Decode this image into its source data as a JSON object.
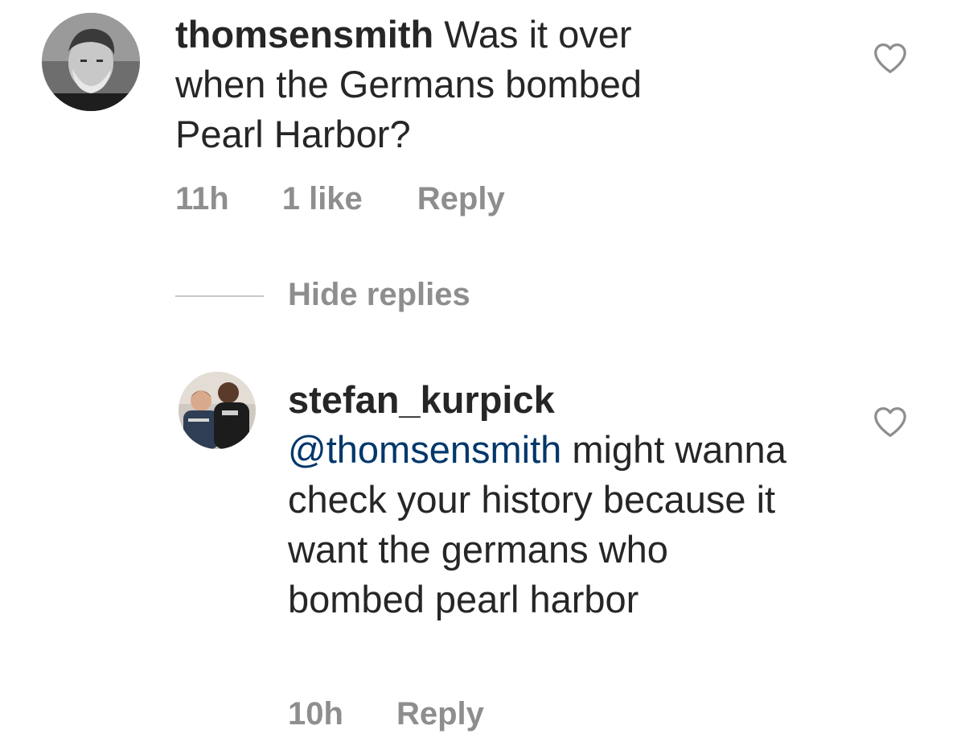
{
  "comment": {
    "username": "thomsensmith",
    "text": "Was it over when the Germans bombed Pearl Harbor?",
    "time": "11h",
    "likes": "1 like",
    "reply_label": "Reply"
  },
  "replies_toggle": {
    "label": "Hide replies"
  },
  "reply": {
    "username": "stefan_kurpick",
    "mention": "@thomsensmith",
    "text": "might wanna check your history because it want the germans who bombed pearl harbor",
    "time": "10h",
    "reply_label": "Reply"
  },
  "icons": {
    "like": "heart-outline-icon"
  },
  "colors": {
    "text": "#262626",
    "meta": "#8e8e8e",
    "mention": "#00376b",
    "divider": "#c7c7c7"
  }
}
